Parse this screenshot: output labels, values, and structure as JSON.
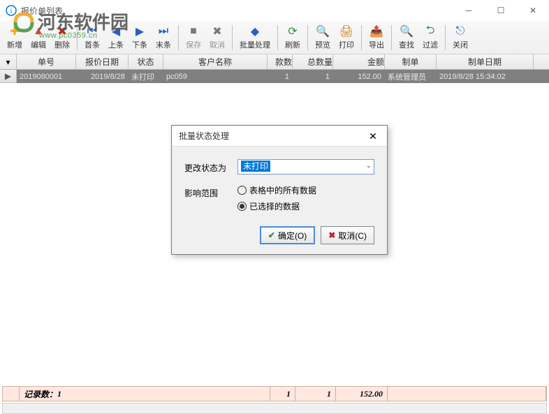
{
  "window": {
    "title": "报价单列表"
  },
  "watermark": {
    "name": "河东软件园",
    "url": "www.pc0359.cn"
  },
  "toolbar": {
    "new": "新增",
    "edit": "编辑",
    "delete": "删除",
    "first": "首条",
    "prev": "上条",
    "next": "下条",
    "last": "末条",
    "save": "保存",
    "cancel": "取消",
    "batch": "批量处理",
    "refresh": "刷新",
    "preview": "预览",
    "print": "打印",
    "export": "导出",
    "find": "查找",
    "filter": "过滤",
    "close": "关闭"
  },
  "columns": {
    "danhao": "单号",
    "baojiariqi": "报价日期",
    "zhuangtai": "状态",
    "kehumingcheng": "客户名称",
    "kuanshu": "款数",
    "zongshuliang": "总数量",
    "jine": "金额",
    "zhidan": "制单",
    "zhidanriqi": "制单日期"
  },
  "rows": [
    {
      "danhao": "2019080001",
      "baojiariqi": "2019/8/28",
      "zhuangtai": "未打印",
      "kehumingcheng": "pc059",
      "kuanshu": "1",
      "zongshuliang": "1",
      "jine": "152.00",
      "zhidan": "系统管理员",
      "zhidanriqi": "2019/8/28 15:34:02"
    }
  ],
  "footer": {
    "record_count_label": "记录数：",
    "record_count": "1",
    "kuanshu_sum": "1",
    "zongshuliang_sum": "1",
    "jine_sum": "152.00"
  },
  "dialog": {
    "title": "批量状态处理",
    "change_status_label": "更改状态为",
    "change_status_value": "未打印",
    "scope_label": "影响范围",
    "scope_all": "表格中的所有数据",
    "scope_selected": "已选择的数据",
    "ok": "确定(O)",
    "cancel": "取消(C)"
  }
}
